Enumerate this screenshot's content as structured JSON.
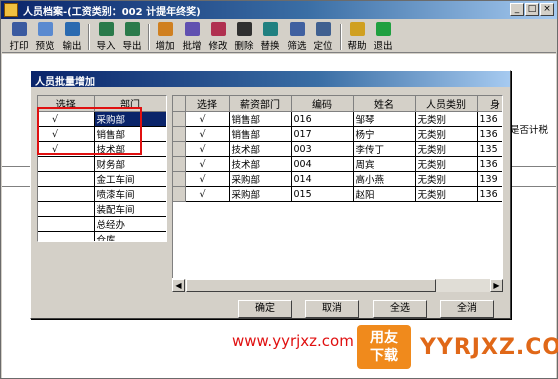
{
  "window": {
    "title": "人员档案-(工资类别：002 计提年终奖)"
  },
  "toolbar": {
    "buttons": [
      {
        "label": "打印",
        "color": "#3a5aa0"
      },
      {
        "label": "预览",
        "color": "#5a8ad0"
      },
      {
        "label": "输出",
        "color": "#2a6ab0"
      },
      {
        "label": "导入",
        "color": "#2a7a4a"
      },
      {
        "label": "导出",
        "color": "#2a7a4a"
      },
      {
        "label": "增加",
        "color": "#d08020"
      },
      {
        "label": "批增",
        "color": "#6050b0"
      },
      {
        "label": "修改",
        "color": "#b03050"
      },
      {
        "label": "删除",
        "color": "#303030"
      },
      {
        "label": "替换",
        "color": "#208080"
      },
      {
        "label": "筛选",
        "color": "#4060a0"
      },
      {
        "label": "定位",
        "color": "#406090"
      },
      {
        "label": "帮助",
        "color": "#d0a020"
      },
      {
        "label": "退出",
        "color": "#20a040"
      }
    ]
  },
  "background": {
    "column_label": "是否计税"
  },
  "dialog": {
    "title": "人员批量增加",
    "dept_grid": {
      "headers": [
        "选择",
        "部门"
      ],
      "rows": [
        {
          "check": "√",
          "dept": "采购部"
        },
        {
          "check": "√",
          "dept": "销售部"
        },
        {
          "check": "√",
          "dept": "技术部"
        },
        {
          "check": "",
          "dept": "财务部"
        },
        {
          "check": "",
          "dept": "金工车间"
        },
        {
          "check": "",
          "dept": "喷漆车间"
        },
        {
          "check": "",
          "dept": "装配车间"
        },
        {
          "check": "",
          "dept": "总经办"
        },
        {
          "check": "",
          "dept": "仓库"
        }
      ]
    },
    "people_grid": {
      "headers": [
        "选择",
        "薪资部门",
        "编码",
        "姓名",
        "人员类别",
        "身"
      ],
      "rows": [
        [
          "√",
          "销售部",
          "016",
          "邹琴",
          "无类别",
          "136"
        ],
        [
          "√",
          "销售部",
          "017",
          "杨宁",
          "无类别",
          "136"
        ],
        [
          "√",
          "技术部",
          "003",
          "李传丁",
          "无类别",
          "135"
        ],
        [
          "√",
          "技术部",
          "004",
          "周宾",
          "无类别",
          "136"
        ],
        [
          "√",
          "采购部",
          "014",
          "高小燕",
          "无类别",
          "139"
        ],
        [
          "√",
          "采购部",
          "015",
          "赵阳",
          "无类别",
          "136"
        ]
      ]
    },
    "buttons": {
      "ok": "确定",
      "cancel": "取消",
      "select_all": "全选",
      "clear_all": "全消"
    }
  },
  "watermark": {
    "url": "www.yyrjxz.com",
    "logo_line1": "用友",
    "logo_line2": "下载",
    "brand": "YYRJXZ.COM"
  }
}
